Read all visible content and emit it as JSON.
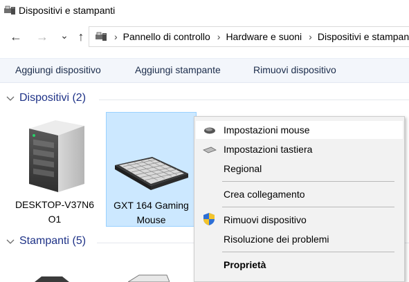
{
  "window": {
    "title": "Dispositivi e stampanti"
  },
  "nav": {
    "back": "←",
    "forward": "→",
    "recent": "⌄",
    "up": "↑",
    "breadcrumbs": [
      "Pannello di controllo",
      "Hardware e suoni",
      "Dispositivi e stampanti"
    ]
  },
  "commands": [
    "Aggiungi dispositivo",
    "Aggiungi stampante",
    "Rimuovi dispositivo"
  ],
  "groups": {
    "devices": {
      "title": "Dispositivi (2)"
    },
    "printers": {
      "title": "Stampanti (5)"
    }
  },
  "devices": [
    {
      "label_line1": "DESKTOP-V37N6",
      "label_line2": "O1",
      "icon": "computer-tower-icon"
    },
    {
      "label_line1": "GXT 164 Gaming",
      "label_line2": "Mouse",
      "icon": "keyboard-icon"
    }
  ],
  "context_menu": {
    "items": [
      {
        "label": "Impostazioni mouse",
        "icon": "mouse-icon"
      },
      {
        "label": "Impostazioni tastiera",
        "icon": "keyboard-small-icon"
      },
      {
        "label": "Regional",
        "icon": ""
      },
      {
        "label": "Crea collegamento",
        "icon": ""
      },
      {
        "label": "Rimuovi dispositivo",
        "icon": "uac-shield-icon"
      },
      {
        "label": "Risoluzione dei problemi",
        "icon": ""
      },
      {
        "label": "Proprietà",
        "icon": ""
      }
    ]
  },
  "colors": {
    "group_title": "#1e3287",
    "selection_bg": "#cce8ff",
    "selection_border": "#99d1ff",
    "cmdbar_bg": "#f3f6fb",
    "menu_bg": "#f2f2f2"
  }
}
